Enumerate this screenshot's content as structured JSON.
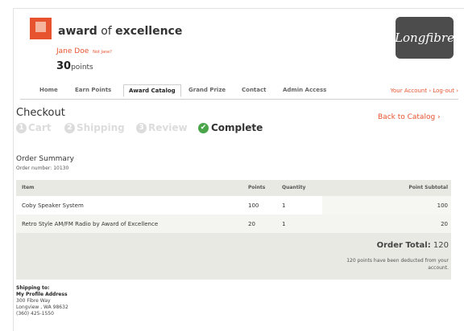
{
  "brand": {
    "name_bold": "award",
    "name_of": "of",
    "name_rest": "excellence",
    "partner_logo": "Longfibre"
  },
  "user": {
    "name": "Jane Doe",
    "not_you": "Not Jane?",
    "points_value": "30",
    "points_label": "points"
  },
  "nav": {
    "tabs": [
      "Home",
      "Earn Points",
      "Award Catalog",
      "Grand Prize",
      "Contact",
      "Admin Access"
    ],
    "active": "Award Catalog",
    "account_links": "Your Account ›  Log-out ›"
  },
  "checkout": {
    "title": "Checkout",
    "back_link": "Back to Catalog ›",
    "steps": [
      {
        "num": "1",
        "label": "Cart"
      },
      {
        "num": "2",
        "label": "Shipping"
      },
      {
        "num": "3",
        "label": "Review"
      },
      {
        "num": "✔",
        "label": "Complete"
      }
    ]
  },
  "order": {
    "summary_title": "Order Summary",
    "order_number": "Order number: 10130",
    "columns": {
      "item": "Item",
      "points": "Points",
      "quantity": "Quantity",
      "subtotal": "Point Subtotal"
    },
    "rows": [
      {
        "item": "Coby Speaker System",
        "points": "100",
        "quantity": "1",
        "subtotal": "100"
      },
      {
        "item": "Retro Style AM/FM Radio by Award of Excellence",
        "points": "20",
        "quantity": "1",
        "subtotal": "20"
      }
    ],
    "total_label": "Order Total:",
    "total_value": "120",
    "deducted_note": "120 points have been deducted from your account."
  },
  "shipping": {
    "heading": "Shipping to:",
    "address_name": "My Profile Address",
    "street": "300 Fibre Way",
    "city": "Longview , WA 98632",
    "phone": "(360) 425-1550"
  },
  "colors": {
    "accent": "#e8532f",
    "complete_green": "#4aa54a",
    "step_inactive": "#dcdcdc"
  }
}
